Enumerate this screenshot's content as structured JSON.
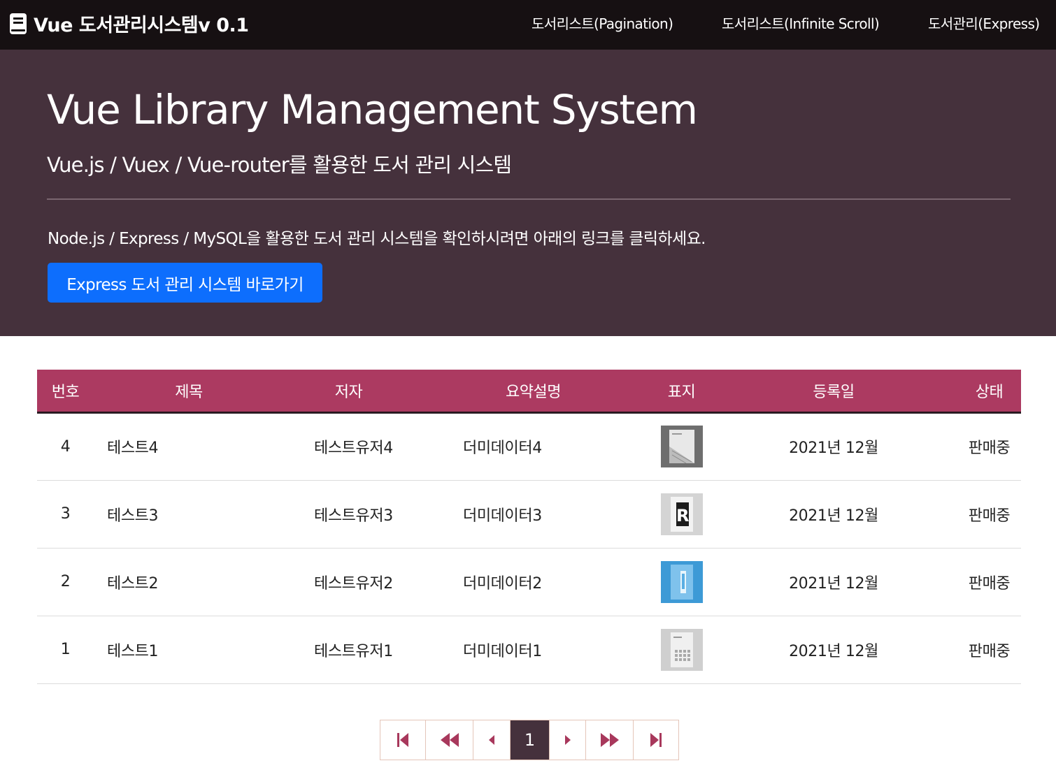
{
  "navbar": {
    "brand": "Vue 도서관리시스템v 0.1",
    "brand_icon": "book-icon",
    "links": [
      {
        "label": "도서리스트(Pagination)"
      },
      {
        "label": "도서리스트(Infinite Scroll)"
      },
      {
        "label": "도서관리(Express)"
      }
    ]
  },
  "hero": {
    "title": "Vue Library Management System",
    "subtitle": "Vue.js / Vuex / Vue-router를 활용한 도서 관리 시스템",
    "text": "Node.js / Express / MySQL을 활용한 도서 관리 시스템을 확인하시려면 아래의 링크를 클릭하세요.",
    "button_label": "Express 도서 관리 시스템 바로가기"
  },
  "table": {
    "headers": [
      "번호",
      "제목",
      "저자",
      "요약설명",
      "표지",
      "등록일",
      "상태"
    ],
    "rows": [
      {
        "no": "4",
        "title": "테스트4",
        "author": "테스트유저4",
        "summary": "더미데이터4",
        "cover": "cover-image",
        "date": "2021년 12월",
        "status": "판매중"
      },
      {
        "no": "3",
        "title": "테스트3",
        "author": "테스트유저3",
        "summary": "더미데이터3",
        "cover": "cover-image",
        "date": "2021년 12월",
        "status": "판매중"
      },
      {
        "no": "2",
        "title": "테스트2",
        "author": "테스트유저2",
        "summary": "더미데이터2",
        "cover": "cover-image",
        "date": "2021년 12월",
        "status": "판매중"
      },
      {
        "no": "1",
        "title": "테스트1",
        "author": "테스트유저1",
        "summary": "더미데이터1",
        "cover": "cover-image",
        "date": "2021년 12월",
        "status": "판매중"
      }
    ]
  },
  "pagination": {
    "current_page": "1",
    "icons": [
      "first-page-icon",
      "prev-block-icon",
      "prev-page-icon",
      "next-page-icon",
      "next-block-icon",
      "last-page-icon"
    ]
  },
  "colors": {
    "navbar_bg": "#161012",
    "hero_bg": "#45313c",
    "table_header_bg": "#ac3a61",
    "button_bg": "#0d6efd",
    "pager_accent": "#a8385c"
  }
}
